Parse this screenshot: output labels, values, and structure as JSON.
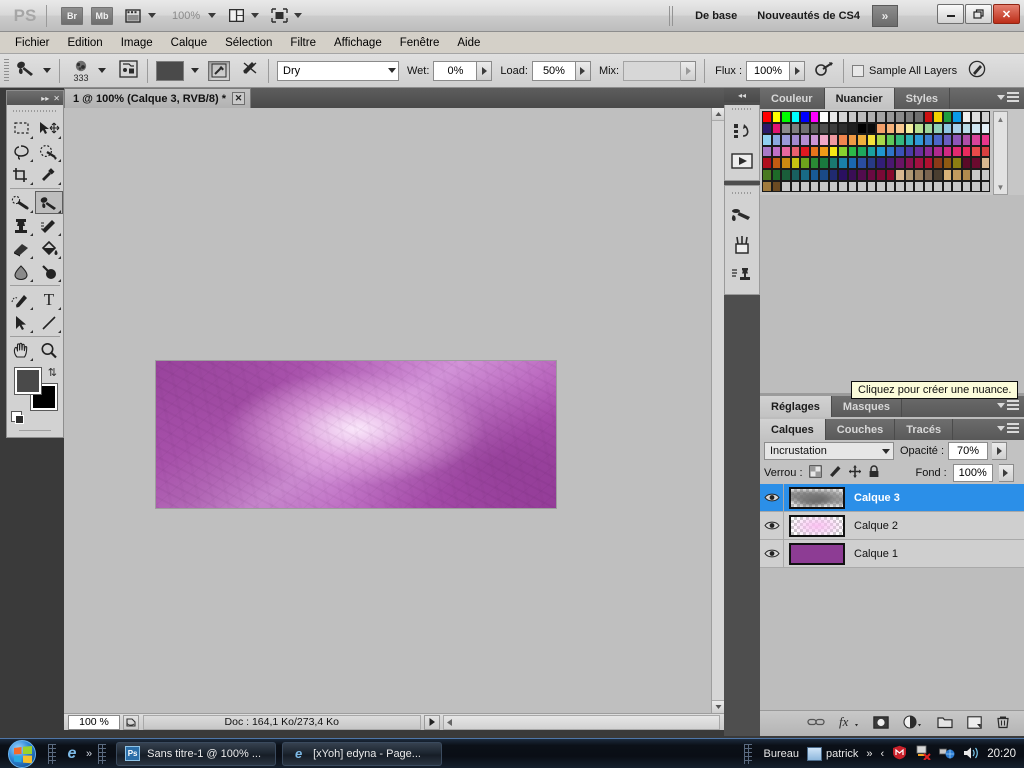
{
  "titlebar": {
    "app_logo": "PS",
    "bridge_button": "Br",
    "minibridge_button": "Mb",
    "view_extras_icon": "view-extras-icon",
    "zoom_level": "100%",
    "arrange_icon": "arrange-documents-icon",
    "screen_mode_icon": "screen-mode-icon",
    "workspace_basic": "De base",
    "workspace_new_cs4": "Nouveautés de CS4",
    "workspace_more": "»",
    "minimize": "━",
    "restore": "❐",
    "close": "✕"
  },
  "menubar": {
    "items": [
      {
        "label": "Fichier"
      },
      {
        "label": "Edition"
      },
      {
        "label": "Image"
      },
      {
        "label": "Calque"
      },
      {
        "label": "Sélection"
      },
      {
        "label": "Filtre"
      },
      {
        "label": "Affichage"
      },
      {
        "label": "Fenêtre"
      },
      {
        "label": "Aide"
      }
    ]
  },
  "options_bar": {
    "tool_icon": "mixer-brush-tool-icon",
    "brush_preset_icon": "brush-preset-icon",
    "brush_size": "333",
    "load_brush_icon": "load-brush-icon",
    "current_load_color": "#4a4a4a",
    "clean_brush_after_stroke_icon": "clean-brush-icon",
    "load_brush_after_stroke_icon": "load-after-stroke-icon",
    "preset_combo_value": "Dry",
    "wet_label": "Wet:",
    "wet_value": "0%",
    "load_label": "Load:",
    "load_value": "50%",
    "mix_label": "Mix:",
    "mix_value": "",
    "flux_label": "Flux :",
    "flux_value": "100%",
    "airbrush_icon": "airbrush-icon",
    "sample_all_layers_label": "Sample All Layers",
    "tablet_pressure_icon": "tablet-pressure-icon"
  },
  "toolbox": {
    "collapse_icon": "collapse-panel-icon",
    "close_icon": "close-panel-icon",
    "tools": [
      {
        "name": "rectangular-marquee-tool",
        "glyph": "marquee"
      },
      {
        "name": "move-tool",
        "glyph": "move"
      },
      {
        "name": "lasso-tool",
        "glyph": "lasso"
      },
      {
        "name": "quick-selection-tool",
        "glyph": "quickselect"
      },
      {
        "name": "crop-tool",
        "glyph": "crop"
      },
      {
        "name": "eyedropper-tool",
        "glyph": "eyedropper"
      },
      {
        "name": "spot-healing-brush-tool",
        "glyph": "heal"
      },
      {
        "name": "mixer-brush-tool",
        "glyph": "brush"
      },
      {
        "name": "clone-stamp-tool",
        "glyph": "stamp"
      },
      {
        "name": "history-brush-tool",
        "glyph": "historybrush"
      },
      {
        "name": "eraser-tool",
        "glyph": "eraser"
      },
      {
        "name": "gradient-paint-bucket-tool",
        "glyph": "bucket"
      },
      {
        "name": "blur-tool",
        "glyph": "blur"
      },
      {
        "name": "dodge-tool",
        "glyph": "dodge"
      },
      {
        "name": "pen-tool",
        "glyph": "pen"
      },
      {
        "name": "horizontal-type-tool",
        "glyph": "type"
      },
      {
        "name": "path-selection-tool",
        "glyph": "pathselect"
      },
      {
        "name": "line-shape-tool",
        "glyph": "line"
      },
      {
        "name": "hand-tool",
        "glyph": "hand"
      },
      {
        "name": "zoom-tool",
        "glyph": "zoom"
      }
    ],
    "active_tool": "mixer-brush-tool",
    "foreground_color": "#4a4a4a",
    "background_color": "#000000",
    "swap_colors_icon": "swap-colors-icon",
    "default_colors_icon": "default-colors-icon"
  },
  "document": {
    "tab_title": "1 @ 100% (Calque 3, RVB/8) *",
    "tab_close_icon": "close-tab-icon",
    "canvas_background": "#bfbfbf"
  },
  "status_bar": {
    "zoom_value": "100 %",
    "doc_icon": "document-info-icon",
    "doc_info": "Doc : 164,1 Ko/273,4 Ko",
    "expand_icon": "status-expand-icon"
  },
  "vertical_dock": {
    "collapse_icon": "collapse-dock-icon",
    "icons": [
      {
        "name": "history-panel-icon"
      },
      {
        "name": "actions-panel-icon"
      },
      {
        "name": "brush-panel-icon"
      },
      {
        "name": "brush-presets-panel-icon"
      },
      {
        "name": "clone-source-panel-icon"
      }
    ]
  },
  "swatches_panel": {
    "tabs": [
      {
        "label": "Couleur",
        "active": false
      },
      {
        "label": "Nuancier",
        "active": true
      },
      {
        "label": "Styles",
        "active": false
      }
    ],
    "menu_icon": "panel-menu-icon",
    "scroll_up_icon": "scroll-up-icon",
    "scroll_down_icon": "scroll-down-icon",
    "colors": [
      "#ff0000",
      "#ffff00",
      "#00ff00",
      "#00ffff",
      "#0000ff",
      "#ff00ff",
      "#ffffff",
      "#e8e8e8",
      "#d6d6d6",
      "#c8c8c8",
      "#bcbcbc",
      "#b0b0b0",
      "#a4a4a4",
      "#989898",
      "#8a8a8a",
      "#7c7c7c",
      "#6e6e6e",
      "#cc1111",
      "#f2d200",
      "#1f9e3f",
      "#0a9ae8",
      "#f0f0f0",
      "#e0e0e0",
      "#d0d0d0",
      "#2b1a6b",
      "#e21472",
      "#8c8c8c",
      "#7e7e7e",
      "#707070",
      "#5e5e5e",
      "#4e4e4e",
      "#3d3d3d",
      "#2e2e2e",
      "#1f1f1f",
      "#000000",
      "#0a0a0a",
      "#f3a06a",
      "#f5b27a",
      "#f8c890",
      "#f6f0a0",
      "#b8e090",
      "#9ed69a",
      "#8fd0b8",
      "#8ec6e2",
      "#a8cfe8",
      "#b7dbe8",
      "#cfe6f2",
      "#e2eef6",
      "#8fd0f0",
      "#8aa8e0",
      "#9a9ad8",
      "#a28ad0",
      "#b48ed2",
      "#cc96d6",
      "#f0a8c8",
      "#f09aa0",
      "#f2864e",
      "#f09a44",
      "#f0b03c",
      "#f5e23a",
      "#a8d84a",
      "#5ec85a",
      "#34b87e",
      "#2fb0b8",
      "#2f9ad8",
      "#3f7fd0",
      "#4c66c8",
      "#6a5ec0",
      "#8f56b8",
      "#b04ea8",
      "#d8449a",
      "#e8368c",
      "#a878c8",
      "#c070c8",
      "#e868a0",
      "#e8606e",
      "#e01820",
      "#e8741c",
      "#f09a18",
      "#f7e815",
      "#88d22e",
      "#2cb848",
      "#1ea85c",
      "#1aa0a0",
      "#1f96d0",
      "#2e74c8",
      "#3a52b8",
      "#4a3aa8",
      "#6a2e9e",
      "#8e2a96",
      "#b02a8e",
      "#d02a82",
      "#e22a70",
      "#ea2a5e",
      "#e84a4a",
      "#d84040",
      "#b00d1c",
      "#c25a12",
      "#cc8a12",
      "#c8c412",
      "#6ea41c",
      "#2a8a34",
      "#1a7a3e",
      "#1a7a70",
      "#1a80a8",
      "#1a68b0",
      "#2a4ea0",
      "#283a86",
      "#321e78",
      "#4a1870",
      "#6a1464",
      "#8a1050",
      "#a21040",
      "#b01030",
      "#8a3a18",
      "#8e5a12",
      "#8a7e12",
      "#5a0a28",
      "#6a0a2e",
      "#d8b890",
      "#4a7a20",
      "#1e6a28",
      "#1a5e3a",
      "#186060",
      "#186a86",
      "#185a96",
      "#1a4a88",
      "#202a70",
      "#2a1060",
      "#3a0e56",
      "#520c4e",
      "#6a0a42",
      "#7a0a36",
      "#880a2c",
      "#d8b890",
      "#b09874",
      "#9a8060",
      "#7a6450",
      "#4a3e30",
      "#d8b278",
      "#c29a5e",
      "#b08a4e",
      "#c8c8c8",
      "#c8c8c8",
      "#a07a3c",
      "#6a4a22",
      "#c8c8c8",
      "#c8c8c8",
      "#c8c8c8",
      "#c8c8c8",
      "#c8c8c8",
      "#c8c8c8",
      "#c8c8c8",
      "#c8c8c8",
      "#c8c8c8",
      "#c8c8c8",
      "#c8c8c8",
      "#c8c8c8",
      "#c8c8c8",
      "#c8c8c8",
      "#c8c8c8",
      "#c8c8c8",
      "#c8c8c8",
      "#c8c8c8",
      "#c8c8c8",
      "#c8c8c8",
      "#c8c8c8",
      "#c8c8c8"
    ]
  },
  "tooltip": {
    "text": "Cliquez pour créer une nuance."
  },
  "adjustments_panel": {
    "tabs": [
      {
        "label": "Réglages",
        "active": true
      },
      {
        "label": "Masques",
        "active": false
      }
    ],
    "menu_icon": "panel-menu-icon"
  },
  "layers_panel": {
    "tabs": [
      {
        "label": "Calques",
        "active": true
      },
      {
        "label": "Couches",
        "active": false
      },
      {
        "label": "Tracés",
        "active": false
      }
    ],
    "menu_icon": "panel-menu-icon",
    "blend_mode": "Incrustation",
    "opacity_label": "Opacité :",
    "opacity_value": "70%",
    "lock_label": "Verrou :",
    "lock_icons": [
      {
        "name": "lock-transparent-pixels-icon"
      },
      {
        "name": "lock-image-pixels-icon"
      },
      {
        "name": "lock-position-icon"
      },
      {
        "name": "lock-all-icon"
      }
    ],
    "fill_label": "Fond :",
    "fill_value": "100%",
    "layers": [
      {
        "name": "Calque 3",
        "selected": true,
        "thumb_type": "checker-noise",
        "eye": true
      },
      {
        "name": "Calque 2",
        "selected": false,
        "thumb_type": "checker-pink",
        "eye": true
      },
      {
        "name": "Calque 1",
        "selected": false,
        "thumb_type": "solid-purple",
        "eye": true
      }
    ],
    "selection_color": "#2b8fe8",
    "footer_buttons": [
      {
        "name": "link-layers-button",
        "glyph": "link"
      },
      {
        "name": "layer-style-button",
        "glyph": "fx"
      },
      {
        "name": "add-layer-mask-button",
        "glyph": "mask"
      },
      {
        "name": "new-fill-adjustment-button",
        "glyph": "adjust"
      },
      {
        "name": "new-group-button",
        "glyph": "folder"
      },
      {
        "name": "new-layer-button",
        "glyph": "newlayer"
      },
      {
        "name": "delete-layer-button",
        "glyph": "trash"
      }
    ]
  },
  "taskbar": {
    "start_button": "start-orb-icon",
    "quicklaunch": [
      {
        "name": "internet-explorer-quicklaunch-icon",
        "glyph": "e"
      }
    ],
    "quicklaunch_more": "»",
    "windows": [
      {
        "label": "Sans titre-1 @ 100% ...",
        "icon": "photoshop-icon",
        "icon_text": "Ps",
        "active": true
      },
      {
        "label": "[xYoh] edyna - Page...",
        "icon": "internet-explorer-icon",
        "icon_text": "e",
        "active": false
      }
    ],
    "tray": {
      "show_desktop_label": "Bureau",
      "user_label": "patrick",
      "user_icon": "user-folder-icon",
      "expand_icon": "»",
      "hidden_icons_chevron": "‹",
      "security_icon": "mcafee-security-icon",
      "updates_icon": "windows-update-icon",
      "network_icon": "network-icon",
      "volume_icon": "volume-icon",
      "clock": "20:20"
    }
  }
}
